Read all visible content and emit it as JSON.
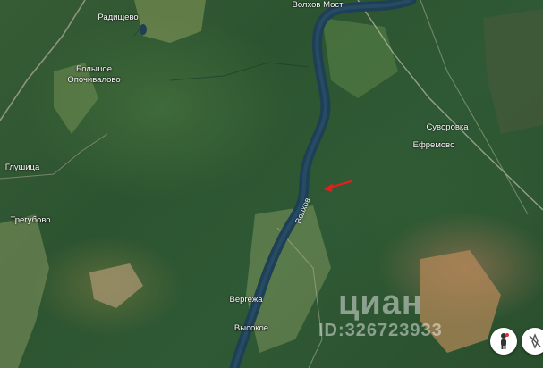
{
  "map": {
    "type": "satellite",
    "places": [
      {
        "id": "radishchevo",
        "label": "Радищево"
      },
      {
        "id": "volkhov-most",
        "label": "Волхов Мост"
      },
      {
        "id": "bolshoe-opochivalovo",
        "label": "Большое\nОпочивалово"
      },
      {
        "id": "suvorovka",
        "label": "Суворовка"
      },
      {
        "id": "efremovo",
        "label": "Ефремово"
      },
      {
        "id": "glushitsa",
        "label": "Глушица"
      },
      {
        "id": "tregubovo",
        "label": "Трегубово"
      },
      {
        "id": "vergezha",
        "label": "Вергежа"
      },
      {
        "id": "vysokoe",
        "label": "Высокое"
      }
    ],
    "river": {
      "label": "Волхов",
      "color": "#1f3f55"
    },
    "marker": {
      "type": "arrow",
      "color": "#e02020"
    }
  },
  "watermark": {
    "brand": "циан",
    "id": "ID:326723933"
  },
  "controls": {
    "street_view_icon": "pegman-icon",
    "compass_icon": "compass-icon"
  }
}
